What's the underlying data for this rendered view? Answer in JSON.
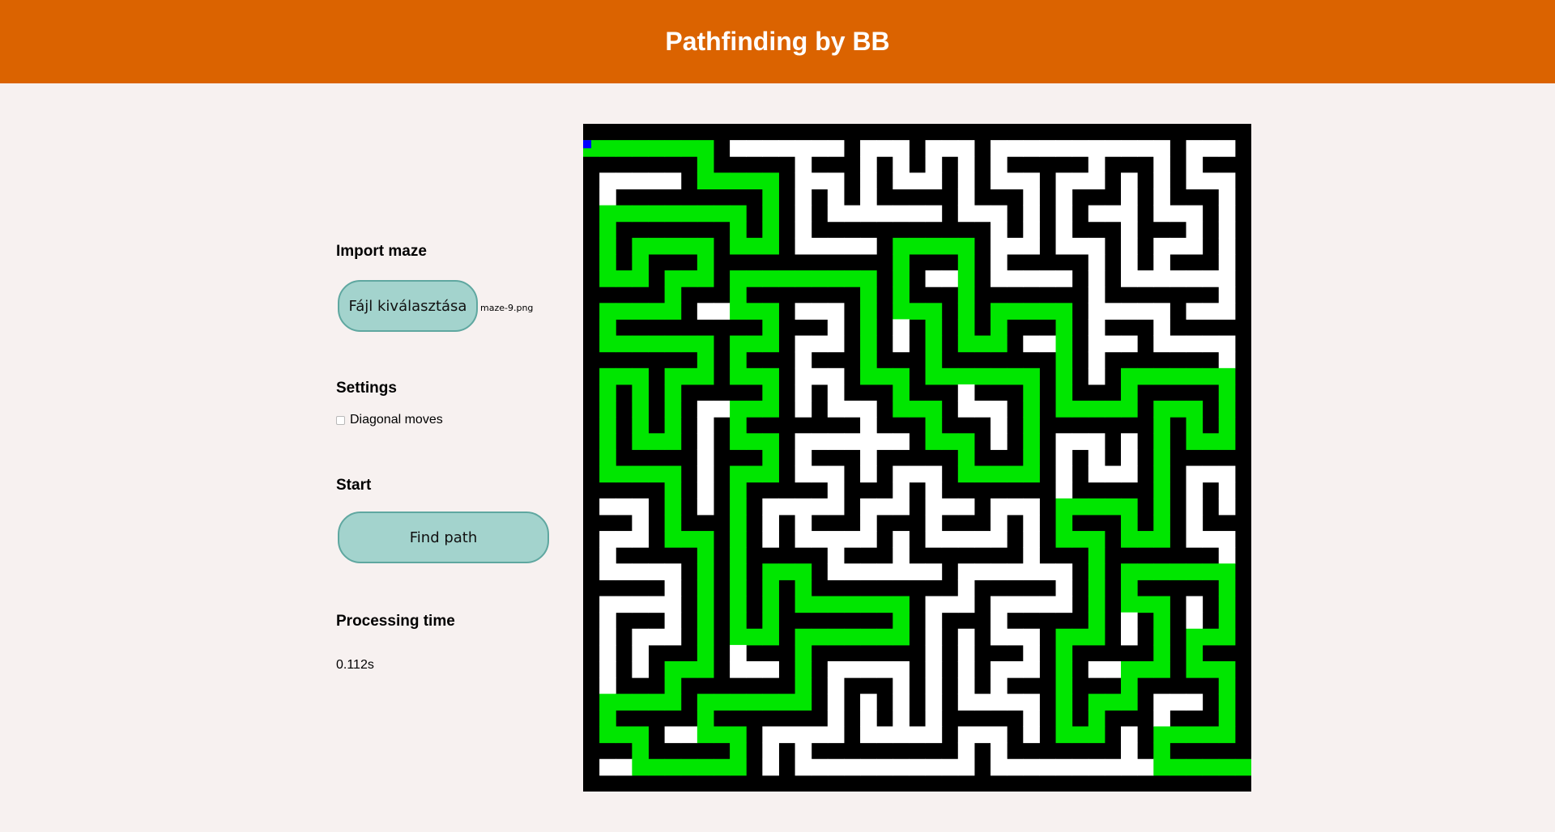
{
  "header": {
    "title": "Pathfinding by BB"
  },
  "import": {
    "heading": "Import maze",
    "file_button_label": "Fájl kiválasztása",
    "file_name": "maze-9.png"
  },
  "settings": {
    "heading": "Settings",
    "diagonal_label": "Diagonal moves",
    "diagonal_checked": false
  },
  "start": {
    "heading": "Start",
    "find_button_label": "Find path"
  },
  "processing": {
    "heading": "Processing time",
    "value": "0.112s"
  },
  "colors": {
    "header_bg": "#db6300",
    "page_bg": "#f7f1f0",
    "button_bg": "#a3d3cd",
    "maze_wall": "#000000",
    "maze_floor": "#ffffff",
    "path": "#00e600",
    "start_marker": "#0000ff"
  },
  "maze": {
    "grid_cells": 41,
    "seed": 9
  }
}
